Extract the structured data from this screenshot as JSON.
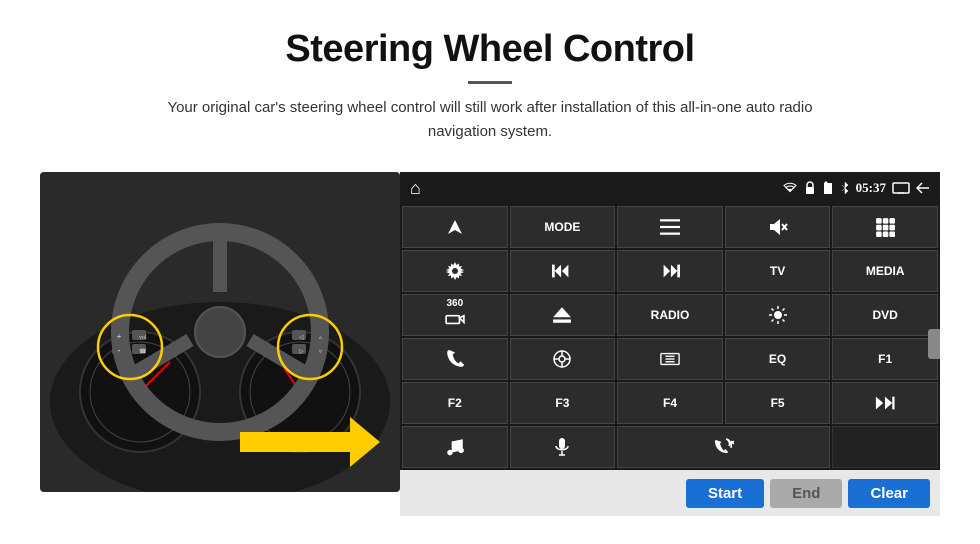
{
  "header": {
    "title": "Steering Wheel Control",
    "subtitle": "Your original car's steering wheel control will still work after installation of this all-in-one auto radio navigation system."
  },
  "statusBar": {
    "homeIcon": "⌂",
    "wifiIcon": "wifi",
    "lockIcon": "🔒",
    "sdIcon": "sd",
    "bluetoothIcon": "bt",
    "time": "05:37",
    "screenIcon": "screen",
    "backIcon": "back"
  },
  "buttons": [
    {
      "id": "nav",
      "type": "icon",
      "label": "▲ nav"
    },
    {
      "id": "mode",
      "type": "text",
      "label": "MODE"
    },
    {
      "id": "list",
      "type": "icon",
      "label": "≡"
    },
    {
      "id": "mute",
      "type": "icon",
      "label": "🔇"
    },
    {
      "id": "apps",
      "type": "icon",
      "label": "⊞"
    },
    {
      "id": "settings",
      "type": "icon",
      "label": "⚙"
    },
    {
      "id": "prev",
      "type": "icon",
      "label": "⏮"
    },
    {
      "id": "next",
      "type": "icon",
      "label": "⏭"
    },
    {
      "id": "tv",
      "type": "text",
      "label": "TV"
    },
    {
      "id": "media",
      "type": "text",
      "label": "MEDIA"
    },
    {
      "id": "cam360",
      "type": "icon",
      "label": "360"
    },
    {
      "id": "eject",
      "type": "icon",
      "label": "⏏"
    },
    {
      "id": "radio",
      "type": "text",
      "label": "RADIO"
    },
    {
      "id": "bright",
      "type": "icon",
      "label": "☀"
    },
    {
      "id": "dvd",
      "type": "text",
      "label": "DVD"
    },
    {
      "id": "phone",
      "type": "icon",
      "label": "📞"
    },
    {
      "id": "navi",
      "type": "icon",
      "label": "◎"
    },
    {
      "id": "screen",
      "type": "icon",
      "label": "▭"
    },
    {
      "id": "eq",
      "type": "text",
      "label": "EQ"
    },
    {
      "id": "f1",
      "type": "text",
      "label": "F1"
    },
    {
      "id": "f2",
      "type": "text",
      "label": "F2"
    },
    {
      "id": "f3",
      "type": "text",
      "label": "F3"
    },
    {
      "id": "f4",
      "type": "text",
      "label": "F4"
    },
    {
      "id": "f5",
      "type": "text",
      "label": "F5"
    },
    {
      "id": "playpause",
      "type": "icon",
      "label": "⏯"
    },
    {
      "id": "music",
      "type": "icon",
      "label": "♫"
    },
    {
      "id": "mic",
      "type": "icon",
      "label": "🎤"
    },
    {
      "id": "call",
      "type": "icon",
      "label": "📲"
    },
    {
      "id": "empty1",
      "type": "empty",
      "label": ""
    },
    {
      "id": "empty2",
      "type": "empty",
      "label": ""
    }
  ],
  "actionBar": {
    "startLabel": "Start",
    "endLabel": "End",
    "clearLabel": "Clear"
  }
}
